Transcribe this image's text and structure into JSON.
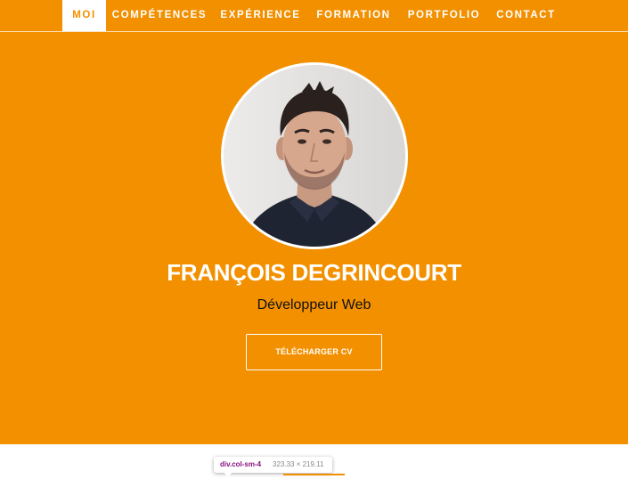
{
  "nav": {
    "items": [
      {
        "label": "MOI",
        "active": true
      },
      {
        "label": "COMPÉTENCES",
        "active": false
      },
      {
        "label": "EXPÉRIENCE",
        "active": false
      },
      {
        "label": "FORMATION",
        "active": false
      },
      {
        "label": "PORTFOLIO",
        "active": false
      },
      {
        "label": "CONTACT",
        "active": false
      }
    ]
  },
  "profile": {
    "name": "FRANÇOIS DEGRINCOURT",
    "title": "Développeur Web",
    "download_cv_label": "TÉLÉCHARGER CV",
    "photo": "portrait-photo"
  },
  "devtools_tooltip": {
    "element": "div.col-sm-4",
    "dimensions": "323.33 × 219.11"
  },
  "colors": {
    "accent": "#f39000",
    "text_on_accent": "#ffffff",
    "subtitle": "#111111",
    "devtools_tag": "#881280"
  }
}
